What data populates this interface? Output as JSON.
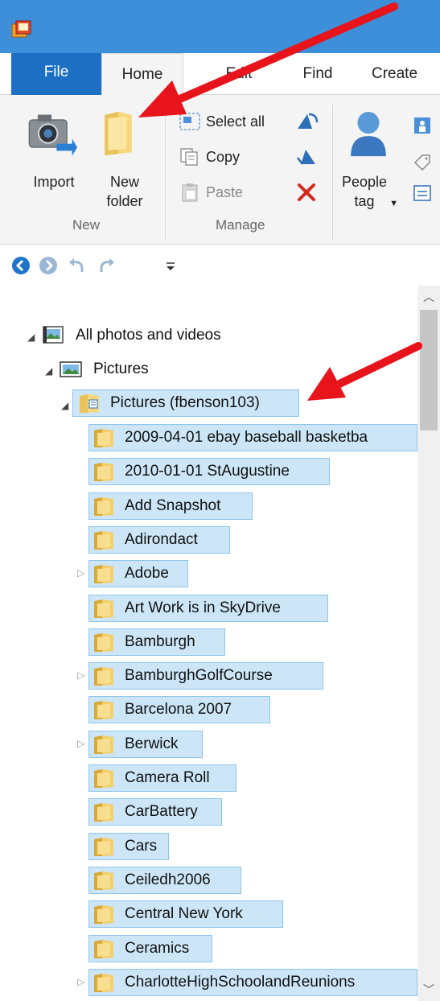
{
  "titlebar": {
    "app_icon": "photo-gallery-icon"
  },
  "tabs": [
    {
      "label": "File"
    },
    {
      "label": "Home"
    },
    {
      "label": "Edit"
    },
    {
      "label": "Find"
    },
    {
      "label": "Create"
    }
  ],
  "ribbon": {
    "new_group": {
      "label": "New",
      "import_label": "Import",
      "new_folder_label": "New folder"
    },
    "manage_group": {
      "label": "Manage",
      "select_all": "Select all",
      "copy": "Copy",
      "paste": "Paste"
    },
    "people_group": {
      "people_tag_label": "People tag"
    }
  },
  "tree": {
    "root": "All photos and videos",
    "pictures": "Pictures",
    "library": "Pictures (fbenson103)",
    "folders": [
      {
        "name": "2009-04-01 ebay baseball basketba",
        "expandable": false
      },
      {
        "name": "2010-01-01 StAugustine",
        "expandable": false
      },
      {
        "name": "Add Snapshot",
        "expandable": false
      },
      {
        "name": "Adirondact",
        "expandable": false
      },
      {
        "name": "Adobe",
        "expandable": true
      },
      {
        "name": "Art Work is in SkyDrive",
        "expandable": false
      },
      {
        "name": "Bamburgh",
        "expandable": false
      },
      {
        "name": "BamburghGolfCourse",
        "expandable": true
      },
      {
        "name": "Barcelona 2007",
        "expandable": false
      },
      {
        "name": "Berwick",
        "expandable": true
      },
      {
        "name": "Camera Roll",
        "expandable": false
      },
      {
        "name": "CarBattery",
        "expandable": false
      },
      {
        "name": "Cars",
        "expandable": false
      },
      {
        "name": "Ceiledh2006",
        "expandable": false
      },
      {
        "name": "Central New York",
        "expandable": false
      },
      {
        "name": "Ceramics",
        "expandable": false
      },
      {
        "name": "CharlotteHighSchoolandReunions",
        "expandable": true
      }
    ]
  },
  "colors": {
    "titlebar": "#3c8fd8",
    "file_tab": "#1c6fc2",
    "selection": "#cce6f7",
    "selection_border": "#8ec5ec",
    "annotation_arrow": "#e8141c"
  }
}
